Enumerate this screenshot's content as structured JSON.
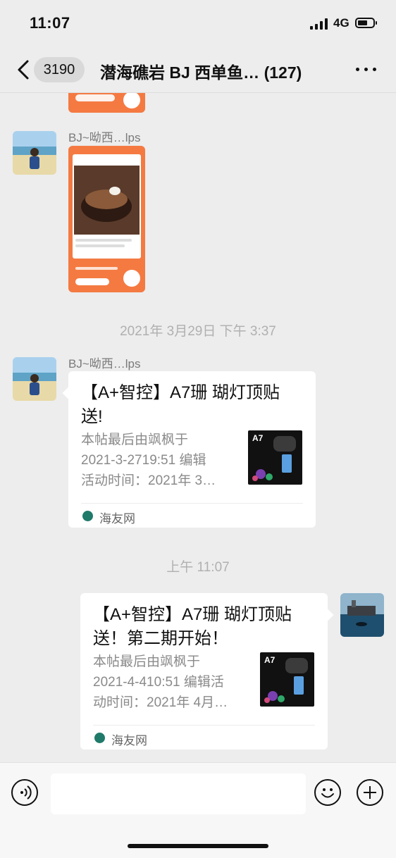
{
  "status": {
    "time": "11:07",
    "network": "4G"
  },
  "nav": {
    "badge": "3190",
    "title": "潜海礁岩 BJ 西单鱼…  (127)"
  },
  "messages": [
    {
      "type": "image",
      "sender": ""
    },
    {
      "type": "image",
      "sender": "BJ~呦西…lps"
    },
    {
      "type": "timestamp",
      "text": "2021年 3月29日 下午 3:37"
    },
    {
      "type": "link",
      "sender": "BJ~呦西…lps",
      "title_lines": [
        "【A+智控】A7珊 瑚灯顶贴",
        "送!"
      ],
      "desc_lines": [
        "本帖最后由飒枫于",
        "2021-3-2719:51 编辑",
        "活动时间：2021年 3…"
      ],
      "thumb_label": "A7",
      "source": "海友网"
    },
    {
      "type": "timestamp",
      "text": "上午 11:07"
    },
    {
      "type": "link",
      "sender": "me",
      "title_lines": [
        "【A+智控】A7珊 瑚灯顶贴",
        "送！第二期开始！"
      ],
      "desc_lines": [
        "本帖最后由飒枫于",
        "2021-4-410:51 编辑活",
        "动时间：2021年 4月…"
      ],
      "thumb_label": "A7",
      "source": "海友网"
    }
  ],
  "input": {
    "placeholder": ""
  },
  "colors": {
    "background": "#ededed",
    "card": "#ffffff",
    "orange": "#f47a42",
    "source_icon": "#1f7a6a"
  },
  "icons": [
    "back-icon",
    "more-icon",
    "voice-icon",
    "emoji-icon",
    "plus-icon",
    "signal-icon",
    "battery-icon"
  ]
}
